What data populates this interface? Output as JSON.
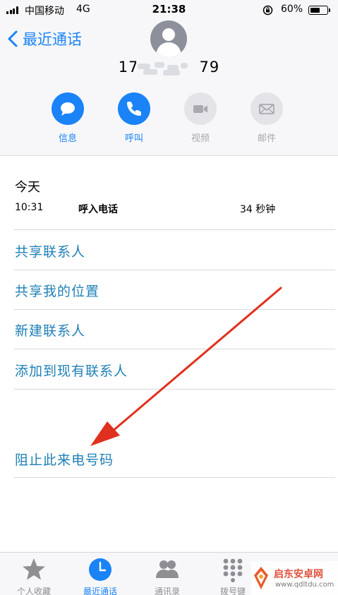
{
  "status_bar": {
    "carrier": "中国移动",
    "network": "4G",
    "time": "21:38",
    "battery_percent": "60%",
    "battery_level": 0.6
  },
  "nav": {
    "back_label": "最近通话"
  },
  "contact": {
    "number_prefix": "17",
    "number_suffix": "79"
  },
  "actions": [
    {
      "label": "信息",
      "icon": "message-icon",
      "enabled": true
    },
    {
      "label": "呼叫",
      "icon": "phone-icon",
      "enabled": true
    },
    {
      "label": "视频",
      "icon": "video-icon",
      "enabled": false
    },
    {
      "label": "邮件",
      "icon": "mail-icon",
      "enabled": false
    }
  ],
  "call_log": {
    "day": "今天",
    "entries": [
      {
        "time": "10:31",
        "type": "呼入电话",
        "duration": "34 秒钟"
      }
    ]
  },
  "options": [
    {
      "label": "共享联系人"
    },
    {
      "label": "共享我的位置"
    },
    {
      "label": "新建联系人"
    },
    {
      "label": "添加到现有联系人"
    },
    {
      "label": "阻止此来电号码"
    }
  ],
  "tabs": [
    {
      "label": "个人收藏",
      "icon": "star-icon",
      "active": false
    },
    {
      "label": "最近通话",
      "icon": "clock-icon",
      "active": true
    },
    {
      "label": "通讯录",
      "icon": "contacts-icon",
      "active": false
    },
    {
      "label": "拨号键",
      "icon": "keypad-icon",
      "active": false
    }
  ],
  "watermark": {
    "name": "启东安卓网",
    "url": "www.qdltdu.com"
  },
  "colors": {
    "accent": "#1a83f7",
    "option_text": "#1f7fb6",
    "annotation_arrow": "#e0301e"
  }
}
